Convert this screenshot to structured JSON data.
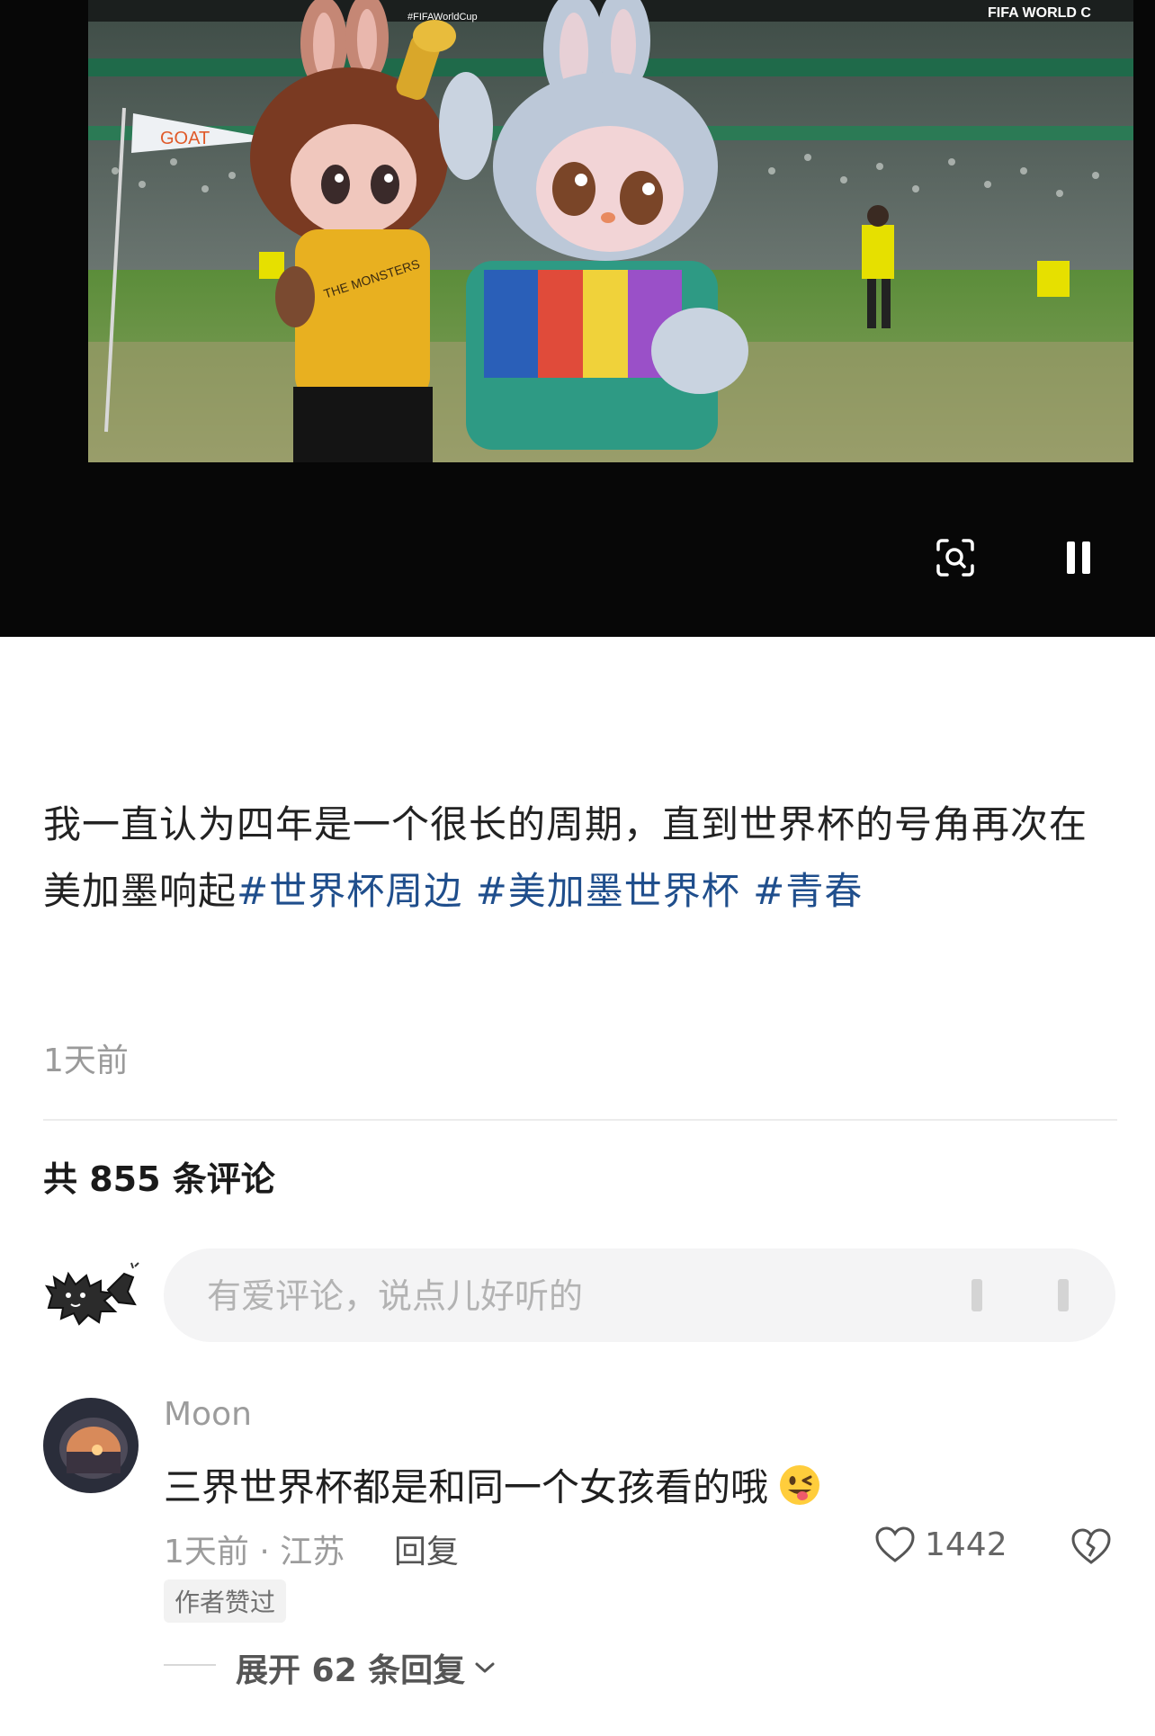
{
  "video": {
    "scoreboard_text": "FIFA WORLD C",
    "hashtag_text": "#FIFAWorldCup",
    "flag_text": "GOAT",
    "shirt_text": "THE MONSTERS",
    "lens_icon": "visual-search-icon",
    "pause_icon": "pause-icon"
  },
  "post": {
    "caption_text": "我一直认为四年是一个很长的周期，直到世界杯的号角再次在美加墨响起",
    "hashtags": [
      "#世界杯周边",
      "#美加墨世界杯",
      "#青春"
    ],
    "time": "1天前"
  },
  "comments": {
    "count_label": "共 855 条评论",
    "input_placeholder": "有爱评论，说点儿好听的",
    "items": [
      {
        "user": "Moon",
        "text": "三界世界杯都是和同一个女孩看的哦",
        "emoji": "winking-face-with-tongue",
        "meta": "1天前 · 江苏",
        "reply_label": "回复",
        "likes": "1442",
        "badge": "作者赞过",
        "expand_label": "展开 62 条回复"
      }
    ]
  },
  "colors": {
    "hashtag": "#1f4e8c",
    "muted": "#9c9c9c",
    "input_bg": "#f4f4f5",
    "video_bg": "#070707"
  }
}
